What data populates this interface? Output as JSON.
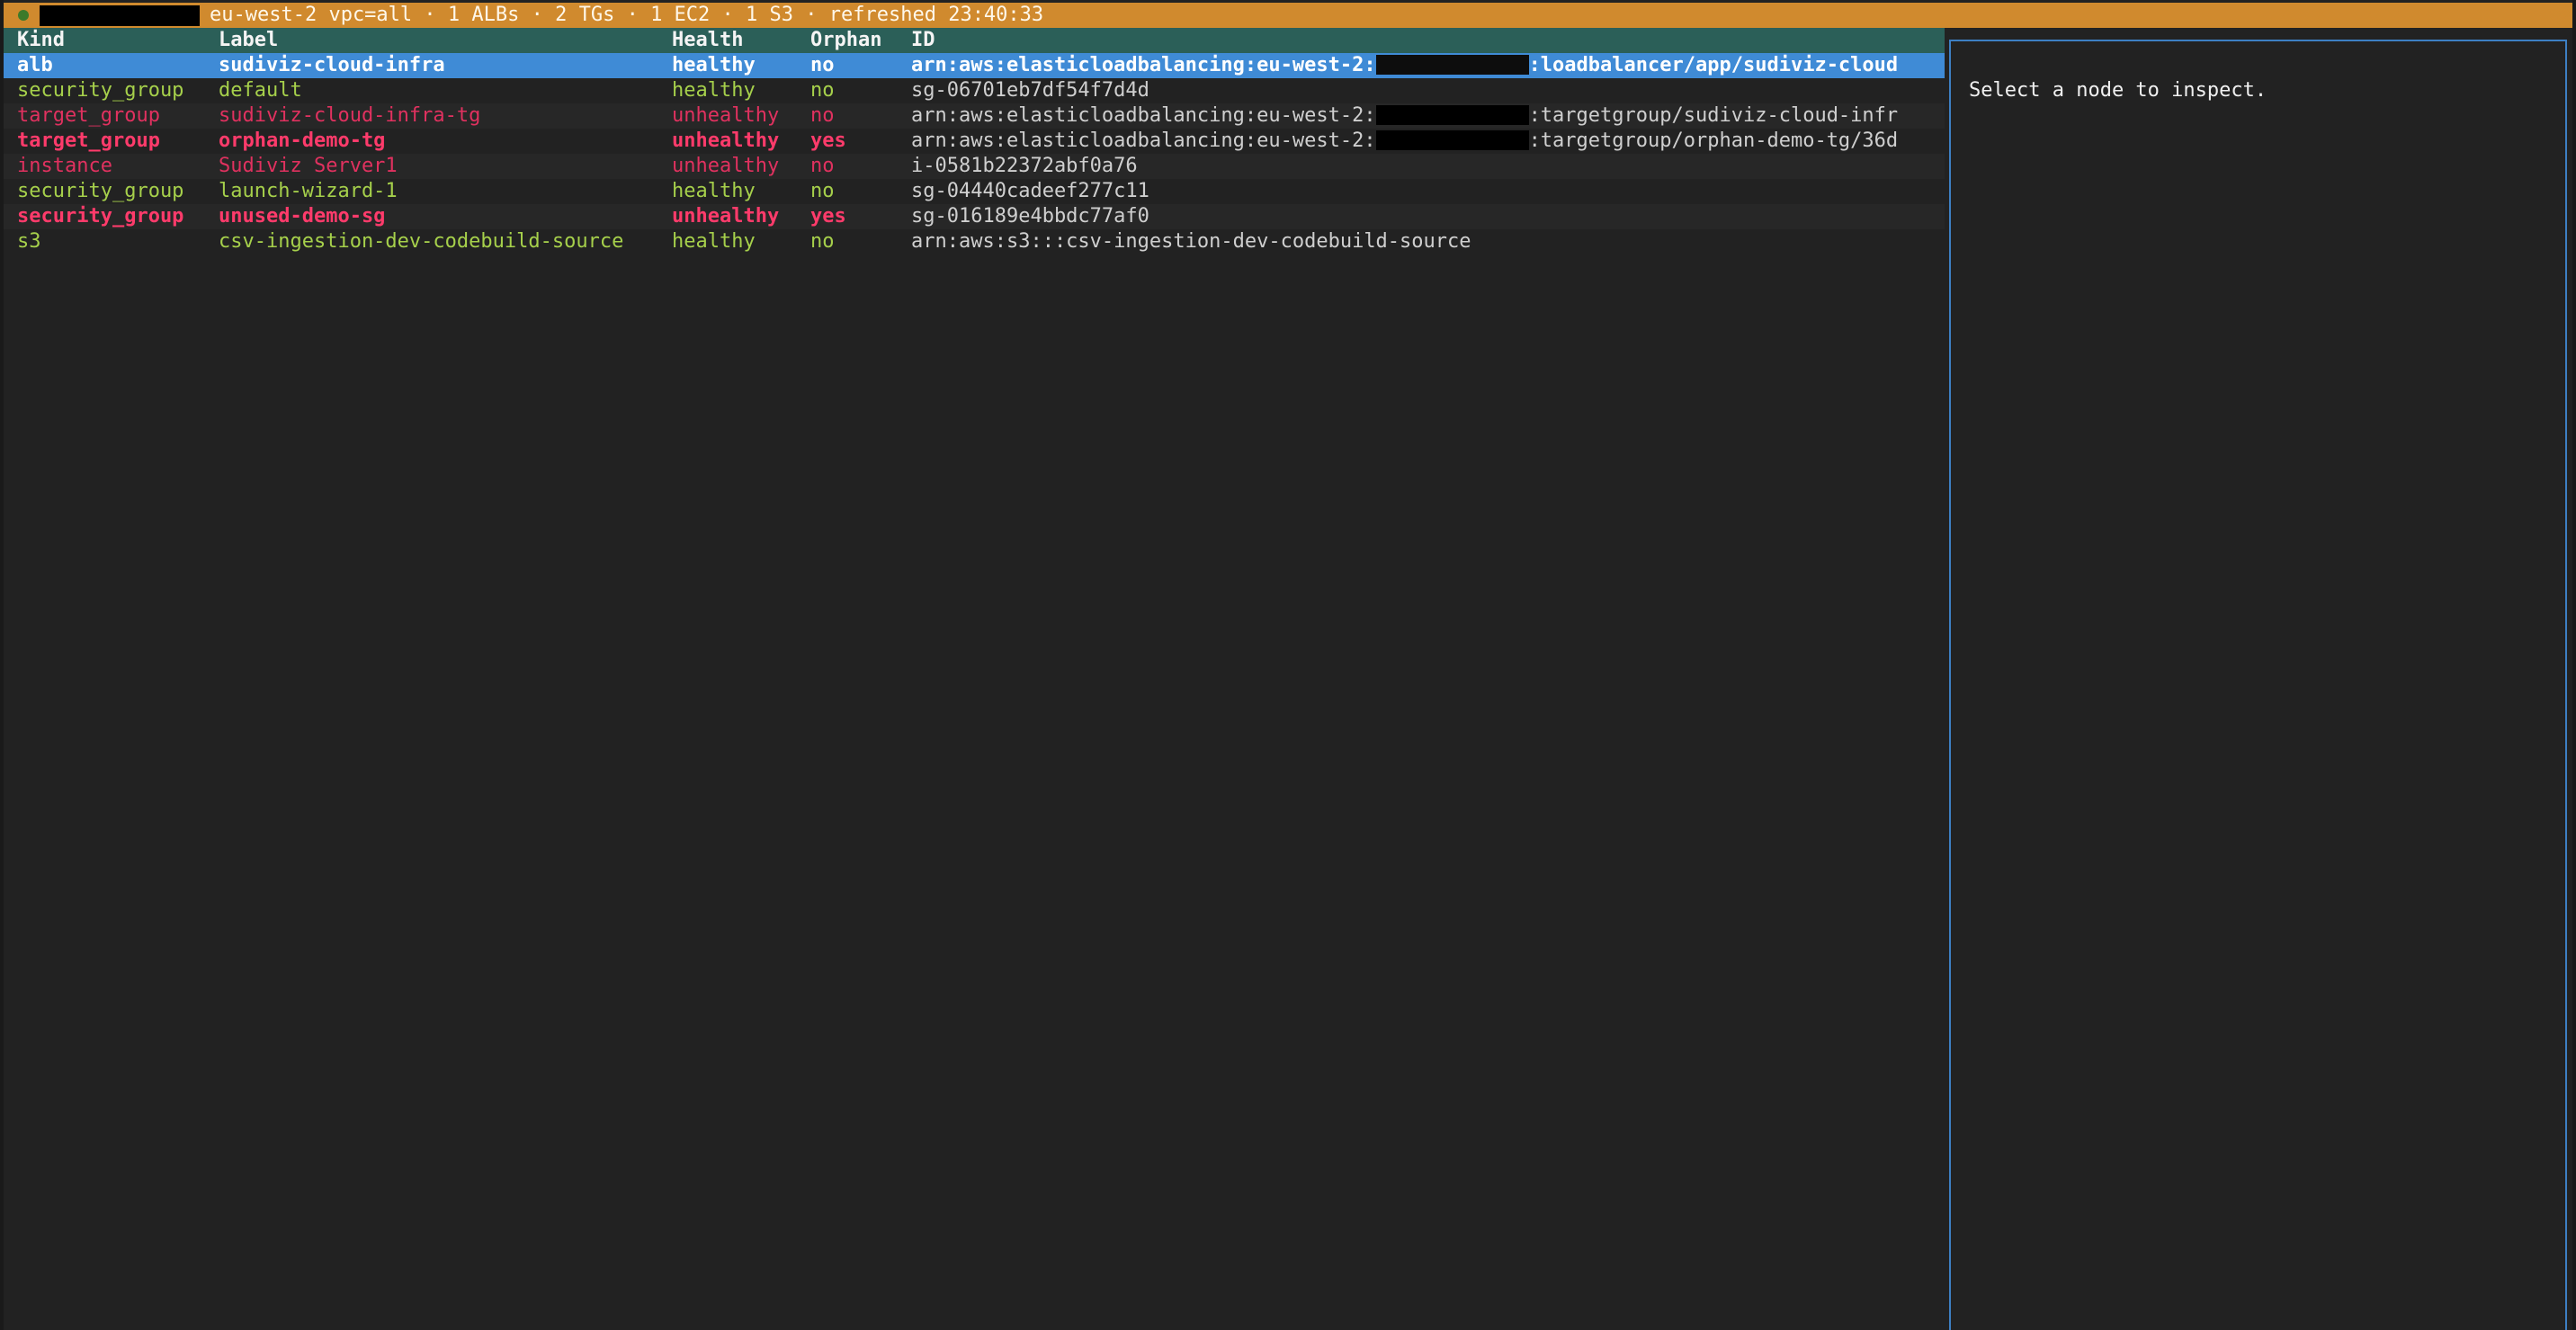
{
  "status_bar": {
    "profile_redacted": "",
    "text": "eu-west-2 vpc=all · 1 ALBs · 2 TGs · 1 EC2 · 1 S3 · refreshed 23:40:33",
    "accent_color": "#d08a2e",
    "dot_color": "#3d7a2a"
  },
  "table": {
    "columns": [
      "Kind",
      "Label",
      "Health",
      "Orphan",
      "ID"
    ],
    "rows": [
      {
        "kind": "alb",
        "label": "sudiviz-cloud-infra",
        "health": "healthy",
        "orphan": "no",
        "id_prefix": "arn:aws:elasticloadbalancing:eu-west-2:",
        "id_suffix": ":loadbalancer/app/sudiviz-cloud",
        "selected": true
      },
      {
        "kind": "security_group",
        "label": "default",
        "health": "healthy",
        "orphan": "no",
        "id_prefix": "sg-06701eb7df54f7d4d",
        "id_suffix": ""
      },
      {
        "kind": "target_group",
        "label": "sudiviz-cloud-infra-tg",
        "health": "unhealthy",
        "orphan": "no",
        "id_prefix": "arn:aws:elasticloadbalancing:eu-west-2:",
        "id_suffix": ":targetgroup/sudiviz-cloud-infr"
      },
      {
        "kind": "target_group",
        "label": "orphan-demo-tg",
        "health": "unhealthy",
        "orphan": "yes",
        "id_prefix": "arn:aws:elasticloadbalancing:eu-west-2:",
        "id_suffix": ":targetgroup/orphan-demo-tg/36d"
      },
      {
        "kind": "instance",
        "label": "Sudiviz Server1",
        "health": "unhealthy",
        "orphan": "no",
        "id_prefix": "i-0581b22372abf0a76",
        "id_suffix": ""
      },
      {
        "kind": "security_group",
        "label": "launch-wizard-1",
        "health": "healthy",
        "orphan": "no",
        "id_prefix": "sg-04440cadeef277c11",
        "id_suffix": ""
      },
      {
        "kind": "security_group",
        "label": "unused-demo-sg",
        "health": "unhealthy",
        "orphan": "yes",
        "id_prefix": "sg-016189e4bbdc77af0",
        "id_suffix": ""
      },
      {
        "kind": "s3",
        "label": "csv-ingestion-dev-codebuild-source",
        "health": "healthy",
        "orphan": "no",
        "id_prefix": "arn:aws:s3:::csv-ingestion-dev-codebuild-source",
        "id_suffix": ""
      }
    ]
  },
  "inspector": {
    "hint": "Select a node to inspect."
  },
  "colors": {
    "header_bg": "#2b5f58",
    "selected_bg": "#3f8bd6",
    "healthy": "#a6d04b",
    "unhealthy": "#e0315f",
    "orphan_bold": "#ff3b6b",
    "inspector_border": "#3d7fc3"
  }
}
